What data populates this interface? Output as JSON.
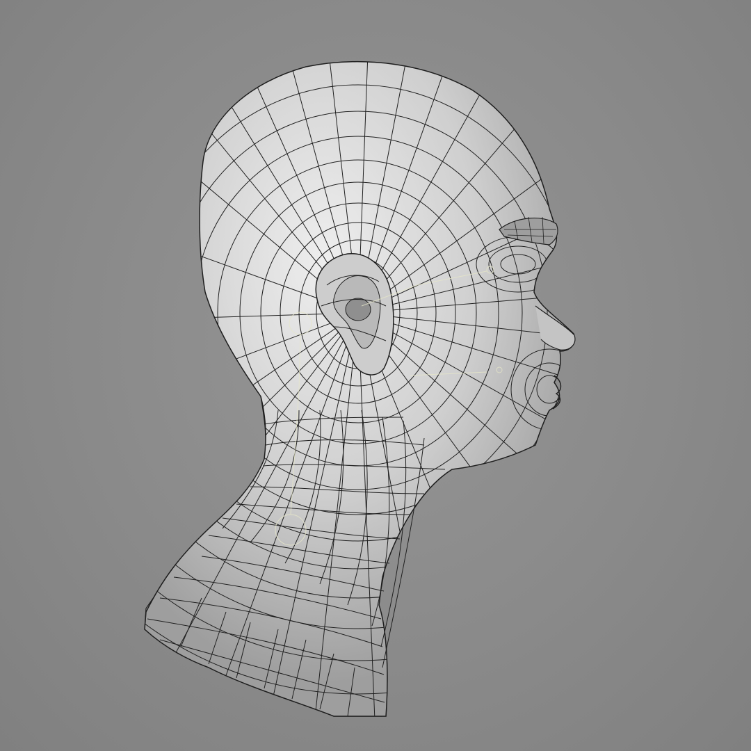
{
  "viewport": {
    "background_color": "#8b8b8b",
    "model": "head-neck-bust",
    "shading": "wireframe-on-shaded",
    "view": "three-quarter-right-profile"
  },
  "colors": {
    "mesh_fill": "#c9c9c9",
    "mesh_highlight": "#e9e9e9",
    "mesh_shadow": "#6a6a6a",
    "wire": "#1e1e1e",
    "rig_guide": "#e6e6c8"
  }
}
